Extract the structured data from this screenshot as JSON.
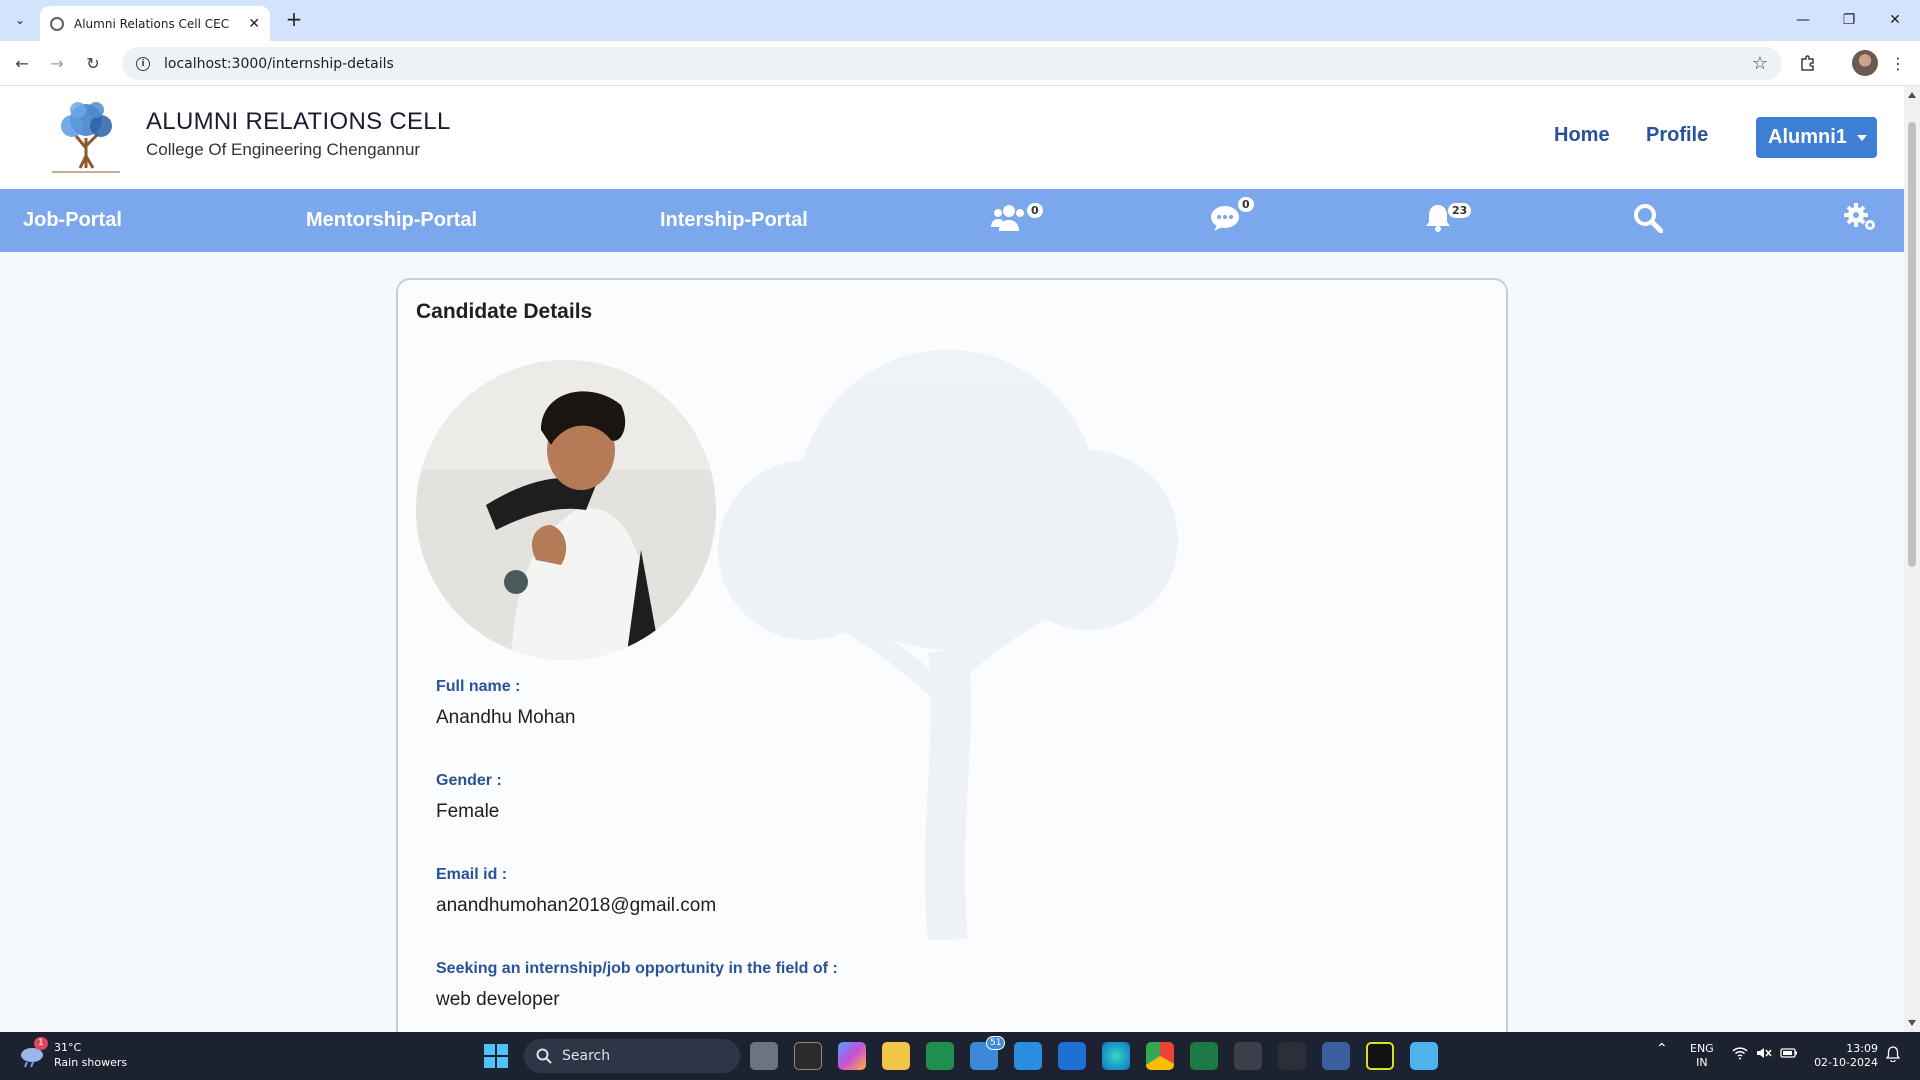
{
  "browser": {
    "tab_title": "Alumni Relations Cell CEC",
    "url": "localhost:3000/internship-details"
  },
  "site": {
    "title": "ALUMNI RELATIONS CELL",
    "subtitle": "College Of Engineering Chengannur",
    "nav": {
      "home": "Home",
      "profile": "Profile",
      "user": "Alumni1"
    }
  },
  "portal_nav": {
    "job": "Job-Portal",
    "mentorship": "Mentorship-Portal",
    "internship": "Intership-Portal",
    "connections_count": "0",
    "messages_count": "0",
    "notifications_count": "23"
  },
  "card": {
    "title": "Candidate Details",
    "fields": [
      {
        "label": "Full name :",
        "value": "Anandhu Mohan"
      },
      {
        "label": "Gender :",
        "value": "Female"
      },
      {
        "label": "Email id :",
        "value": "anandhumohan2018@gmail.com"
      },
      {
        "label": "Seeking an internship/job opportunity in the field of :",
        "value": "web developer"
      }
    ]
  },
  "taskbar": {
    "weather_temp": "31°C",
    "weather_desc": "Rain showers",
    "weather_badge": "1",
    "search_placeholder": "Search",
    "mail_badge": "51",
    "lang_top": "ENG",
    "lang_bottom": "IN",
    "time": "13:09",
    "date": "02-10-2024"
  },
  "colors": {
    "accent": "#7ba7ec",
    "link": "#2a5298",
    "button": "#3e7fd6"
  }
}
